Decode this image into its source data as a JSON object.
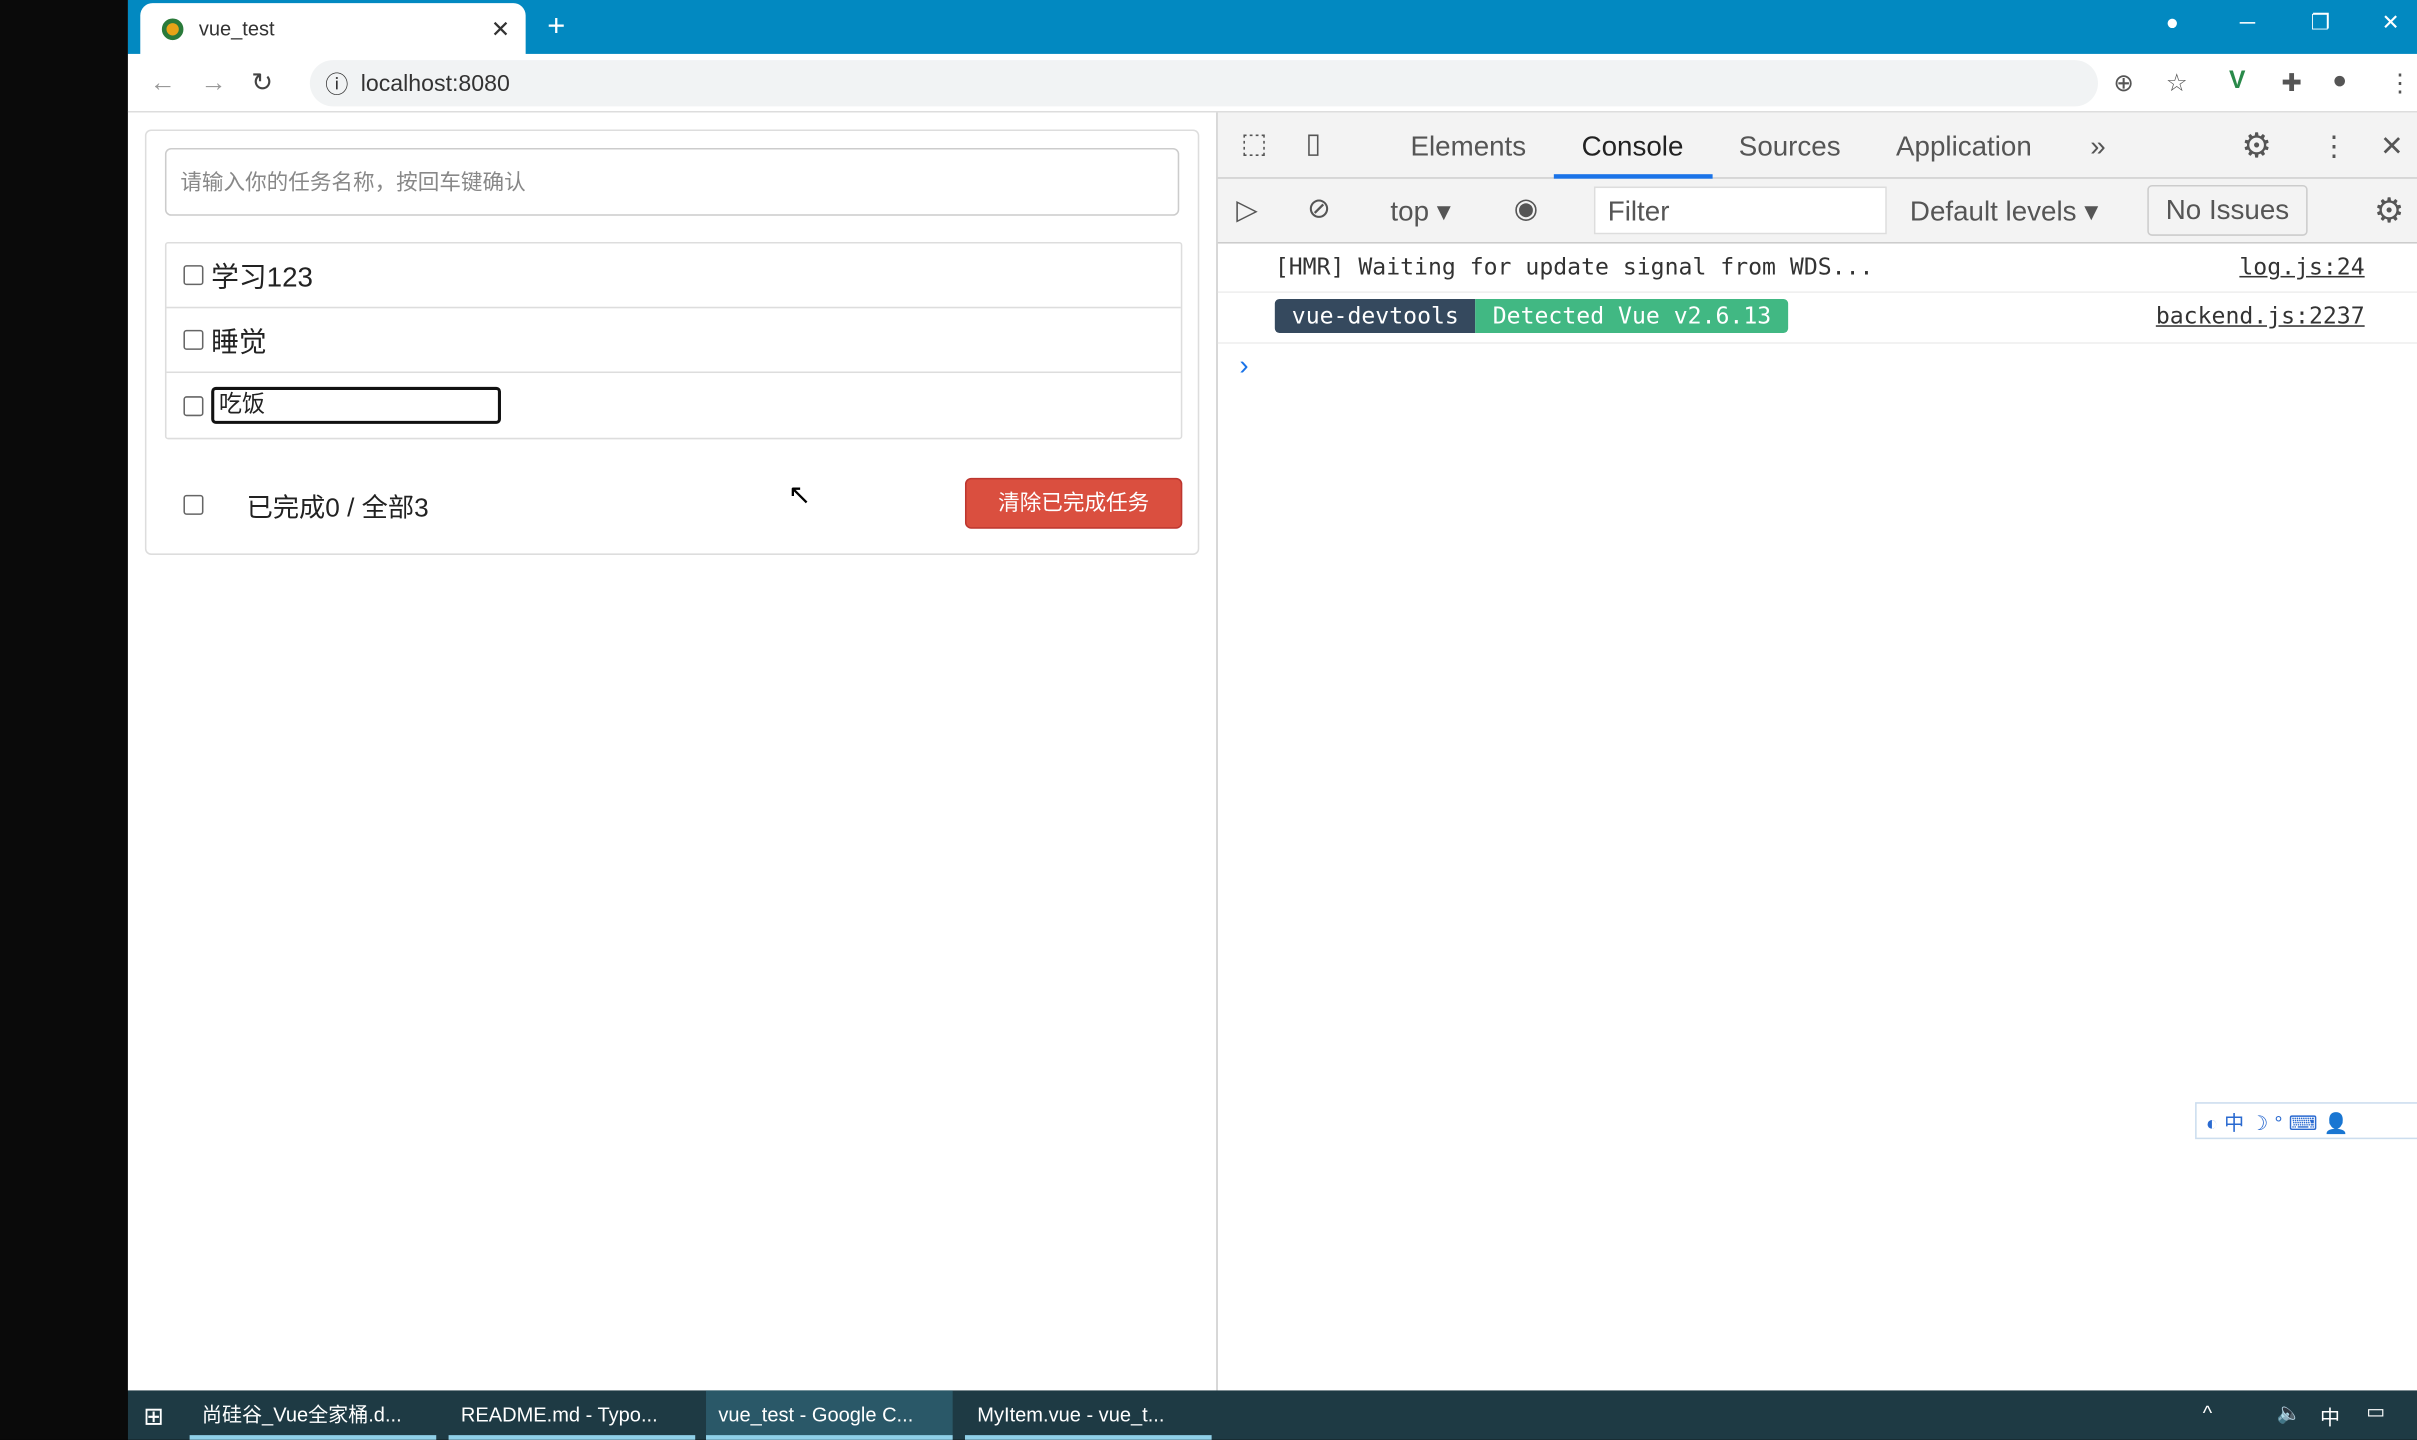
{
  "browser": {
    "tab_title": "vue_test",
    "url": "localhost:8080"
  },
  "app": {
    "new_task_placeholder": "请输入你的任务名称，按回车键确认",
    "todos": [
      {
        "title": "学习123",
        "done": false
      },
      {
        "title": "睡觉",
        "done": false
      },
      {
        "title": "吃饭",
        "done": false,
        "editing": true
      }
    ],
    "footer": {
      "summary": "已完成0 / 全部3",
      "clear_button": "清除已完成任务"
    }
  },
  "devtools": {
    "tabs": [
      "Elements",
      "Console",
      "Sources",
      "Application"
    ],
    "active_tab": "Console",
    "context": "top",
    "filter_placeholder": "Filter",
    "levels": "Default levels",
    "issues": "No Issues",
    "messages": [
      {
        "text": "[HMR] Waiting for update signal from WDS...",
        "source": "log.js:24"
      },
      {
        "badge1": "vue-devtools",
        "badge2": "Detected Vue v2.6.13",
        "source": "backend.js:2237"
      }
    ],
    "prompt": "›"
  },
  "taskbar": {
    "items": [
      "尚硅谷_Vue全家桶.d...",
      "README.md - Typo...",
      "vue_test - Google C...",
      "MyItem.vue - vue_t..."
    ]
  },
  "colors": {
    "tabbar": "#0289c1",
    "danger": "#da4f3f",
    "vue_green": "#41b883",
    "vue_dark": "#35495e"
  }
}
